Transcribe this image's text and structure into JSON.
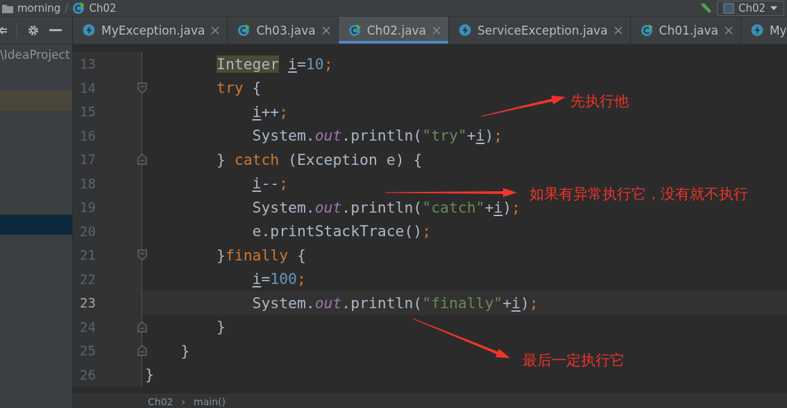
{
  "navbar": {
    "crumbs": [
      {
        "label": "morning",
        "kind": "folder"
      },
      {
        "label": "Ch02",
        "kind": "class"
      }
    ],
    "separator": "/",
    "run_config": {
      "label": "Ch02"
    }
  },
  "project_panel": {
    "path": "\\IdeaProject",
    "rows": [
      {
        "kind": "match"
      },
      {
        "kind": "selected"
      }
    ]
  },
  "tabs": [
    {
      "label": "MyException.java",
      "kind": "exception",
      "selected": false,
      "closable": true
    },
    {
      "label": "Ch03.java",
      "kind": "class",
      "selected": false,
      "closable": true
    },
    {
      "label": "Ch02.java",
      "kind": "class",
      "selected": true,
      "closable": true
    },
    {
      "label": "ServiceException.java",
      "kind": "exception",
      "selected": false,
      "closable": true
    },
    {
      "label": "Ch01.java",
      "kind": "class",
      "selected": false,
      "closable": true
    },
    {
      "label": "My",
      "kind": "exception",
      "selected": false,
      "closable": false
    }
  ],
  "editor": {
    "lines": [
      {
        "number": "13",
        "current": false,
        "kind": "plain",
        "tokens": [
          {
            "text": "        Integer",
            "kind": "match"
          },
          {
            "text": " i",
            "kind": "var"
          },
          {
            "text": "=",
            "kind": "plain"
          },
          {
            "text": "10",
            "kind": "num"
          },
          {
            "text": ";",
            "kind": "punct"
          }
        ]
      },
      {
        "number": "14",
        "current": false,
        "kind": "fold-start",
        "tokens": [
          {
            "text": "        try",
            "kind": "kw"
          },
          {
            "text": " {",
            "kind": "plain"
          }
        ]
      },
      {
        "number": "15",
        "current": false,
        "kind": "plain",
        "tokens": [
          {
            "text": "            i",
            "kind": "var"
          },
          {
            "text": "++",
            "kind": "plain"
          },
          {
            "text": ";",
            "kind": "punct"
          }
        ]
      },
      {
        "number": "16",
        "current": false,
        "kind": "plain",
        "tokens": [
          {
            "text": "            System.",
            "kind": "plain"
          },
          {
            "text": "out",
            "kind": "field"
          },
          {
            "text": ".println(",
            "kind": "plain"
          },
          {
            "text": "\"try\"",
            "kind": "str"
          },
          {
            "text": "+",
            "kind": "plain"
          },
          {
            "text": "i",
            "kind": "var"
          },
          {
            "text": ")",
            "kind": "plain"
          },
          {
            "text": ";",
            "kind": "punct"
          }
        ]
      },
      {
        "number": "17",
        "current": false,
        "kind": "fold-end",
        "tokens": [
          {
            "text": "        } ",
            "kind": "plain"
          },
          {
            "text": "catch",
            "kind": "kw"
          },
          {
            "text": " (Exception e) {",
            "kind": "plain"
          }
        ]
      },
      {
        "number": "18",
        "current": false,
        "kind": "plain",
        "tokens": [
          {
            "text": "            i",
            "kind": "var"
          },
          {
            "text": "--",
            "kind": "plain"
          },
          {
            "text": ";",
            "kind": "punct"
          }
        ]
      },
      {
        "number": "19",
        "current": false,
        "kind": "plain",
        "tokens": [
          {
            "text": "            System.",
            "kind": "plain"
          },
          {
            "text": "out",
            "kind": "field"
          },
          {
            "text": ".println(",
            "kind": "plain"
          },
          {
            "text": "\"catch\"",
            "kind": "str"
          },
          {
            "text": "+",
            "kind": "plain"
          },
          {
            "text": "i",
            "kind": "var"
          },
          {
            "text": ")",
            "kind": "plain"
          },
          {
            "text": ";",
            "kind": "punct"
          }
        ]
      },
      {
        "number": "20",
        "current": false,
        "kind": "plain",
        "tokens": [
          {
            "text": "            e.printStackTrace()",
            "kind": "plain"
          },
          {
            "text": ";",
            "kind": "punct"
          }
        ]
      },
      {
        "number": "21",
        "current": false,
        "kind": "fold-start",
        "tokens": [
          {
            "text": "        }",
            "kind": "plain"
          },
          {
            "text": "finally",
            "kind": "kw"
          },
          {
            "text": " {",
            "kind": "plain"
          }
        ]
      },
      {
        "number": "22",
        "current": false,
        "kind": "plain",
        "tokens": [
          {
            "text": "            i",
            "kind": "var"
          },
          {
            "text": "=",
            "kind": "plain"
          },
          {
            "text": "100",
            "kind": "num"
          },
          {
            "text": ";",
            "kind": "punct"
          }
        ]
      },
      {
        "number": "23",
        "current": true,
        "kind": "plain",
        "tokens": [
          {
            "text": "            System.",
            "kind": "plain"
          },
          {
            "text": "out",
            "kind": "field"
          },
          {
            "text": ".println(",
            "kind": "plain"
          },
          {
            "text": "\"finally\"",
            "kind": "str"
          },
          {
            "text": "+",
            "kind": "plain"
          },
          {
            "text": "i",
            "kind": "var"
          },
          {
            "text": ")",
            "kind": "plain"
          },
          {
            "text": ";",
            "kind": "punct"
          }
        ]
      },
      {
        "number": "24",
        "current": false,
        "kind": "fold-end",
        "tokens": [
          {
            "text": "        }",
            "kind": "plain"
          }
        ]
      },
      {
        "number": "25",
        "current": false,
        "kind": "fold-end",
        "tokens": [
          {
            "text": "    }",
            "kind": "plain"
          }
        ]
      },
      {
        "number": "26",
        "current": false,
        "kind": "plain",
        "tokens": [
          {
            "text": "}",
            "kind": "plain"
          }
        ]
      }
    ],
    "annotations": [
      {
        "text": "先执行他"
      },
      {
        "text": "如果有异常执行它，没有就不执行"
      },
      {
        "text": "最后一定执行它"
      }
    ]
  },
  "breadcrumb": {
    "items": [
      "Ch02",
      "main()"
    ],
    "separator": "›"
  }
}
